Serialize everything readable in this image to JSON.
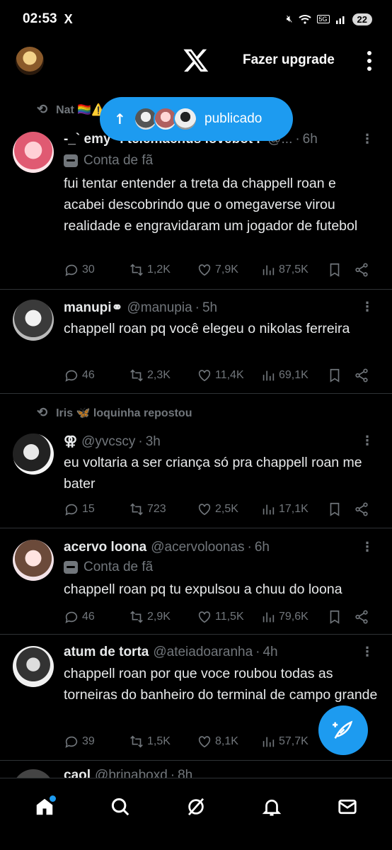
{
  "status_bar": {
    "time": "02:53",
    "app_icon": "X",
    "network": "5G",
    "battery": "22"
  },
  "top_bar": {
    "upgrade_label": "Fazer upgrade"
  },
  "new_posts_pill": {
    "label": "publicado",
    "icon": "arrow-up-icon"
  },
  "posts": [
    {
      "repost_by": "Nat 🏳️‍🌈⚠️",
      "name": "-_` emy *. telemachus lovebot .'",
      "handle": "@...",
      "time": "6h",
      "label": "Conta de fã",
      "text": "fui tentar entender a treta da chappell roan e acabei descobrindo que o omegaverse virou realidade e engravidaram um jogador de futebol",
      "replies": "30",
      "reposts": "1,2K",
      "likes": "7,9K",
      "views": "87,5K"
    },
    {
      "name": "manupi⚭",
      "handle": "@manupia",
      "time": "5h",
      "text": "chappell roan pq você elegeu o nikolas ferreira",
      "replies": "46",
      "reposts": "2,3K",
      "likes": "11,4K",
      "views": "69,1K"
    },
    {
      "repost_by": "Iris 🦋 loquinha repostou",
      "name": "⚢",
      "handle": "@yvcscy",
      "time": "3h",
      "text": "eu voltaria a ser criança só pra chappell roan me bater",
      "replies": "15",
      "reposts": "723",
      "likes": "2,5K",
      "views": "17,1K"
    },
    {
      "name": "acervo loona",
      "handle": "@acervoloonas",
      "time": "6h",
      "label": "Conta de fã",
      "text": "chappell roan pq tu expulsou a chuu do loona",
      "replies": "46",
      "reposts": "2,9K",
      "likes": "11,5K",
      "views": "79,6K"
    },
    {
      "name": "atum de torta",
      "handle": "@ateiadoaranha",
      "time": "4h",
      "text": "chappell roan por que voce roubou todas as torneiras do banheiro do terminal de campo grande",
      "replies": "39",
      "reposts": "1,5K",
      "likes": "8,1K",
      "views": "57,7K"
    },
    {
      "name": "caol",
      "handle": "@brinaboxd",
      "time": "8h"
    }
  ],
  "bottom_nav": [
    "home-icon",
    "search-icon",
    "grok-icon",
    "notifications-icon",
    "messages-icon"
  ],
  "colors": {
    "accent": "#1d9bf0",
    "background": "#000000",
    "muted": "#71767b"
  }
}
